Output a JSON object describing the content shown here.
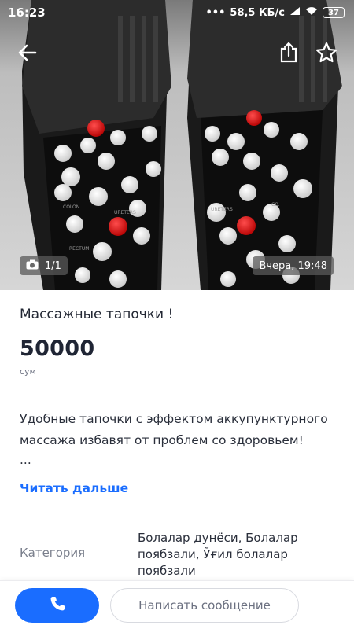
{
  "status_bar": {
    "time": "16:23",
    "network": "58,5 КБ/с",
    "battery": "37"
  },
  "photo": {
    "counter": "1/1",
    "date": "Вчера, 19:48"
  },
  "listing": {
    "title": "Массажные тапочки !",
    "price": "50000",
    "currency": "сум",
    "description": "Удобные тапочки с эффектом аккупунктурного массажа избавят от проблем со здоровьем!",
    "ellipsis": "...",
    "read_more": "Читать дальше"
  },
  "details": {
    "category_label": "Категория",
    "category_value": "Болалар дунёси, Болалар поябзали, Ўғил болалар поябзали"
  },
  "actions": {
    "message_label": "Написать сообщение"
  },
  "colors": {
    "accent": "#1a6dff",
    "text": "#2a2f3b"
  }
}
